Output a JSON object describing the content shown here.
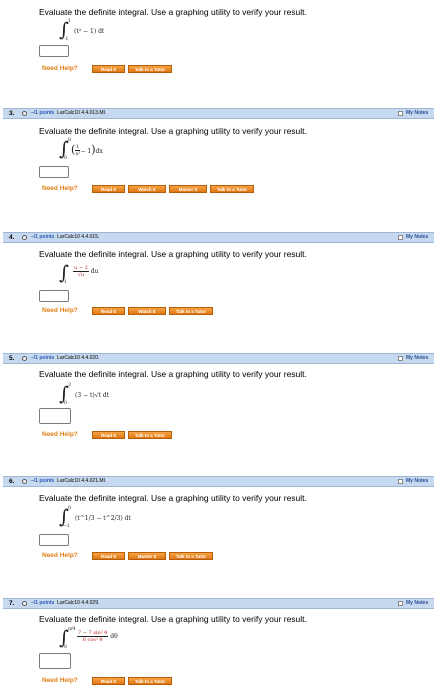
{
  "question": "Evaluate the definite integral. Use a graphing utility to verify your result.",
  "need_help": "Need Help?",
  "my_notes": "My Notes",
  "buttons": {
    "read": "Read It",
    "watch": "Watch It",
    "master": "Master It",
    "tutor": "Talk to a Tutor"
  },
  "problems": [
    {
      "math": {
        "lower": "-1",
        "upper": "1",
        "integrand": "(t² − 1) dt"
      }
    },
    {
      "number": "3.",
      "points": "–/1 points",
      "ref": "LarCalc10 4.4.013.MI.",
      "math": {
        "lower": "0",
        "upper": "8",
        "frac_num": "1",
        "frac_den": "x²",
        "rest": "− 1",
        "diff": "dx"
      }
    },
    {
      "number": "4.",
      "points": "–/1 points",
      "ref": "LarCalc10 4.4.015.",
      "math": {
        "lower": "1",
        "upper": "",
        "frac_num": "u − 2",
        "frac_den": "√u",
        "diff": "du"
      }
    },
    {
      "number": "5.",
      "points": "–/1 points",
      "ref": "LarCalc10 4.4.020.",
      "math": {
        "lower": "0",
        "upper": "3",
        "integrand": "(3 − t)√t dt"
      }
    },
    {
      "number": "6.",
      "points": "–/1 points",
      "ref": "LarCalc10 4.4.021.MI.",
      "math": {
        "lower": "−1",
        "upper": "0",
        "integrand": "(t^1/3 − t^2/3) dt"
      }
    },
    {
      "number": "7.",
      "points": "–/1 points",
      "ref": "LarCalc10 4.4.029.",
      "math": {
        "lower": "0",
        "upper": "π/4",
        "frac_num": "7 − 7 sin² θ",
        "frac_den": "8 cos² θ",
        "diff": "dθ"
      }
    }
  ]
}
